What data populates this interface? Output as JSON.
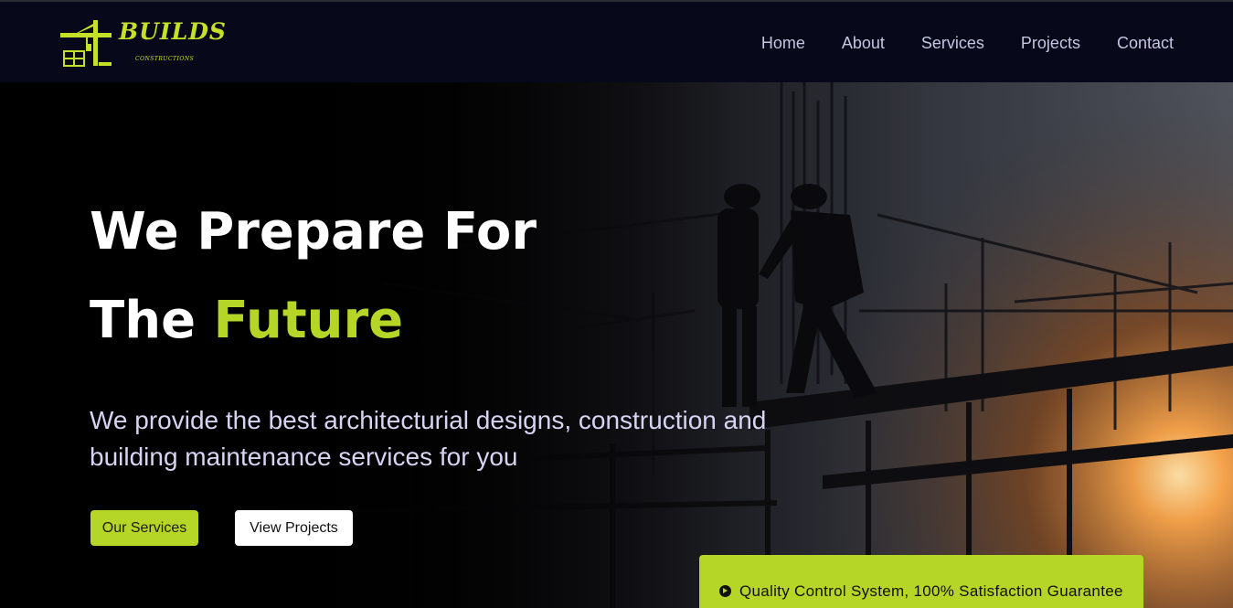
{
  "brand": {
    "name": "BUILDS",
    "tagline": "CONSTRUCTIONS",
    "color": "#c6e02a"
  },
  "nav": {
    "items": [
      "Home",
      "About",
      "Services",
      "Projects",
      "Contact"
    ]
  },
  "hero": {
    "title_line1": "We Prepare For",
    "title_line2_prefix": "The",
    "title_line2_accent": "Future",
    "subtitle": "We provide the best architecturial designs, construction and building maintenance services for you",
    "primary_button": "Our Services",
    "secondary_button": "View Projects",
    "accent_color": "#b5d626"
  },
  "quality": {
    "icon": "play-circle-icon",
    "text": "Quality Control System, 100% Satisfaction Guarantee"
  }
}
